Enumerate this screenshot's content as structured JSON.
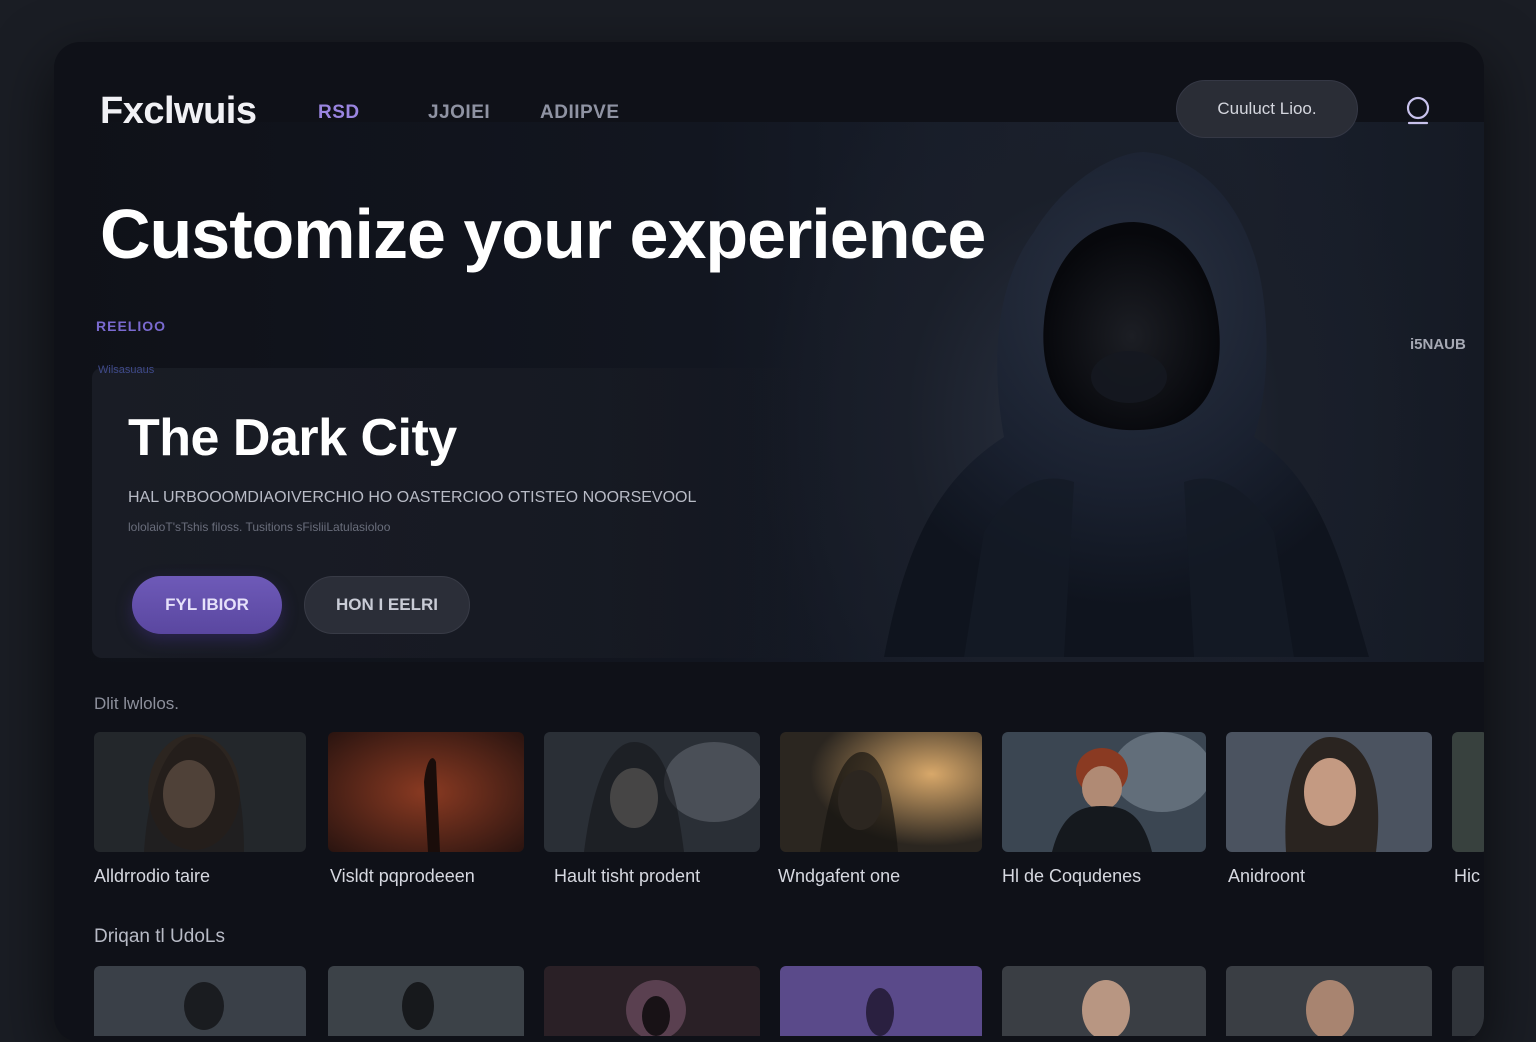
{
  "nav": {
    "logo": "Fxclwuis",
    "links": [
      {
        "label": "RSD",
        "active": true
      },
      {
        "label": "JJOIEI",
        "active": false
      },
      {
        "label": "ADIIPVE",
        "active": false
      }
    ],
    "cta": "Cuuluct Lioo.",
    "search_icon": "search-icon"
  },
  "hero": {
    "headline": "Customize your experience",
    "kicker": "REELIOO",
    "sub_kicker": "Wilsasuaus",
    "side_tag": "i5NAUB",
    "feature": {
      "title": "The Dark City",
      "description": "HAL URBOOOMDIAOIVERCHIO HO OASTERCIOO OTISTEO NOORSEVOOL",
      "description_secondary": "lololaioT'sTshis filoss. Tusitions sFisliiLatulasioloo",
      "primary_button": "FYL IBIOR",
      "secondary_button": "HON I EELRI"
    }
  },
  "rows": [
    {
      "title": "Dlit lwlolos.",
      "items": [
        {
          "label": "Alldrrodio taire"
        },
        {
          "label": "Visldt pqprodeeen"
        },
        {
          "label": "Hault tisht prodent"
        },
        {
          "label": "Wndgafent one"
        },
        {
          "label": "Hl de Coqudenes"
        },
        {
          "label": "Anidroont"
        },
        {
          "label": "Hic"
        }
      ]
    },
    {
      "title": "Driqan tl UdoLs",
      "items": [
        {},
        {},
        {},
        {},
        {},
        {},
        {}
      ]
    }
  ],
  "colors": {
    "accent": "#6e5ab8",
    "background": "#0f1118",
    "page": "#1a1d24"
  }
}
